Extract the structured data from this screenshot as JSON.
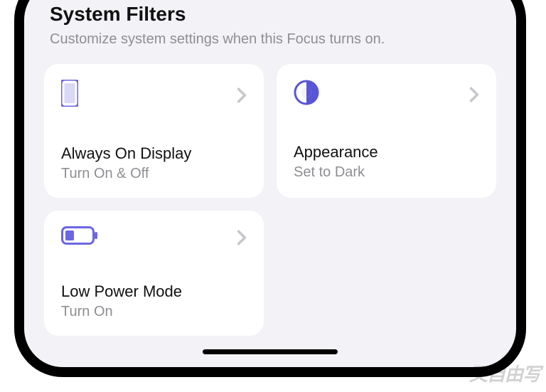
{
  "section": {
    "title": "System Filters",
    "subtitle": "Customize system settings when this Focus turns on."
  },
  "cards": {
    "aod": {
      "title": "Always On Display",
      "subtitle": "Turn On & Off"
    },
    "appearance": {
      "title": "Appearance",
      "subtitle": "Set to Dark"
    },
    "lowpower": {
      "title": "Low Power Mode",
      "subtitle": "Turn On"
    }
  },
  "colors": {
    "accent": "#6b66e2",
    "accent_alt": "#5856d6"
  },
  "watermark": "又自由写"
}
